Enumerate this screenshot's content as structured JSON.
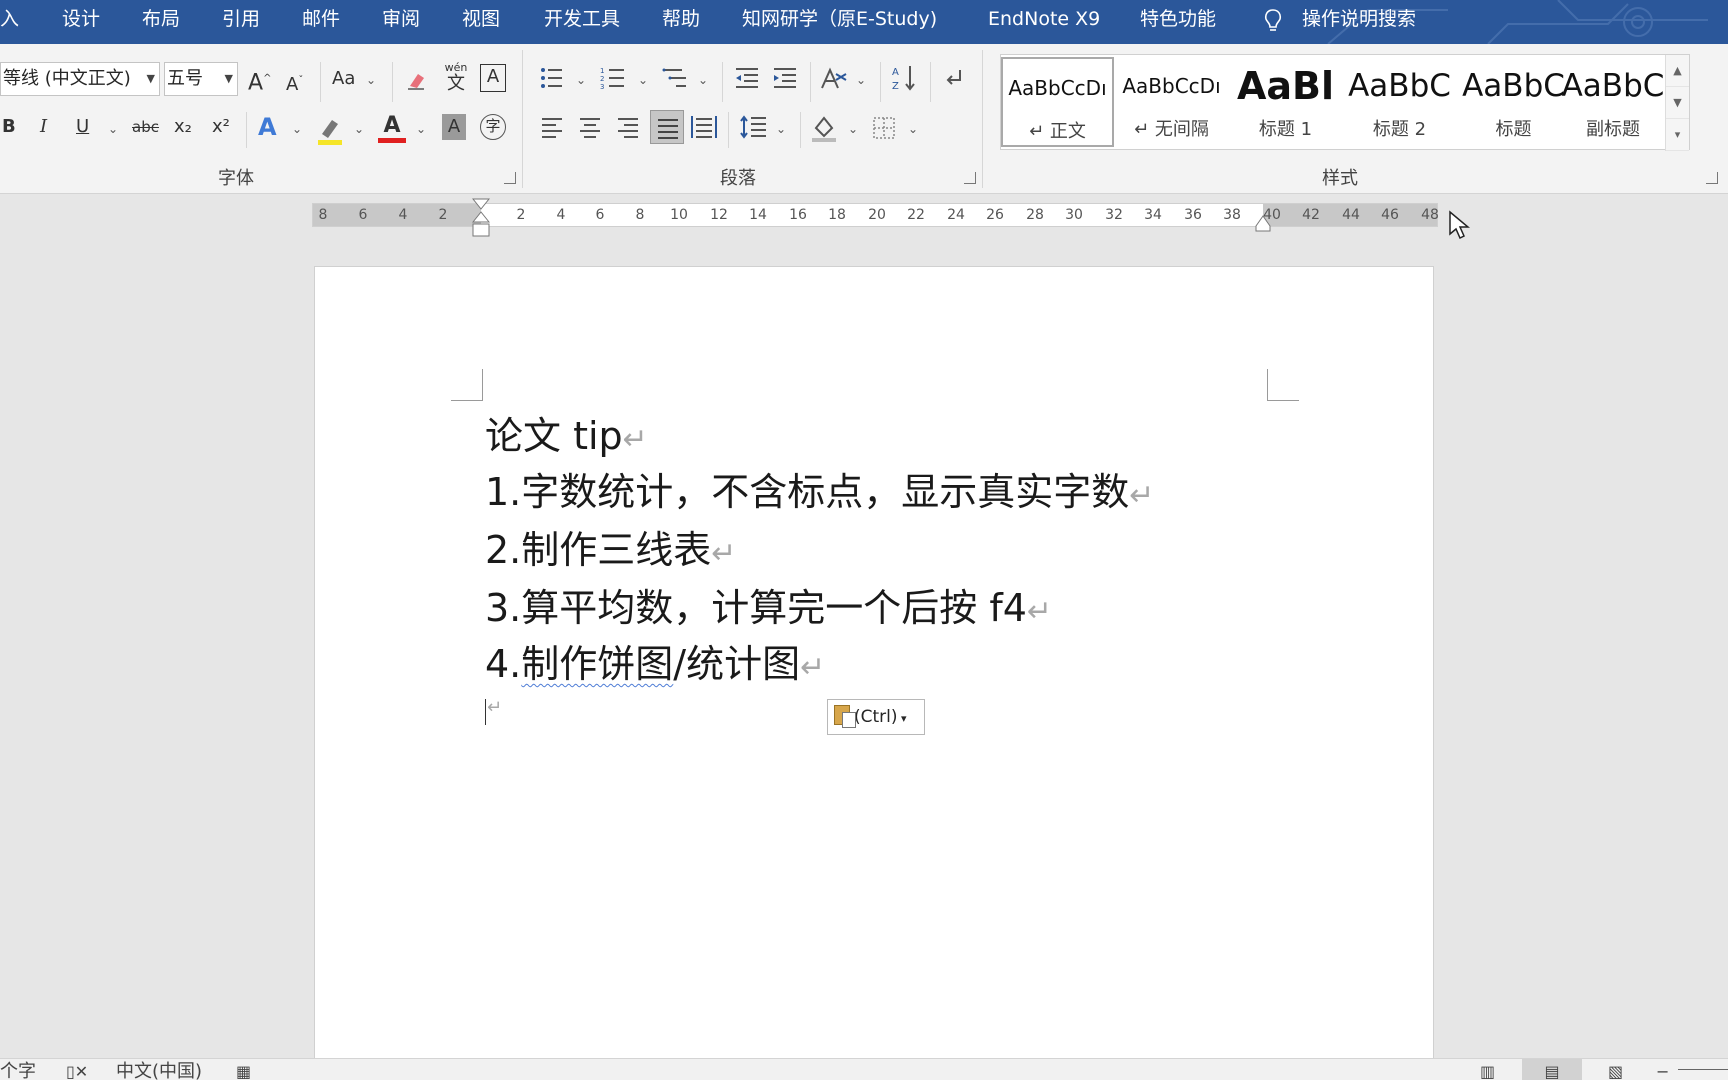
{
  "menu": {
    "tabs": [
      "入",
      "设计",
      "布局",
      "引用",
      "邮件",
      "审阅",
      "视图",
      "开发工具",
      "帮助",
      "知网研学（原E-Study)",
      "EndNote X9",
      "特色功能"
    ],
    "search_label": "操作说明搜索",
    "accent_color": "#2b579a"
  },
  "ribbon": {
    "font_group": {
      "label": "字体",
      "font_name": "等线 (中文正文)",
      "font_size": "五号",
      "change_case": "Aa",
      "bold": "B",
      "italic": "I",
      "underline": "U",
      "strikethrough": "abc",
      "subscript": "x₂",
      "superscript": "x²",
      "phonetic": "wén",
      "phonetic_char": "文"
    },
    "paragraph_group": {
      "label": "段落"
    },
    "styles_group": {
      "label": "样式",
      "items": [
        {
          "sample": "AaBbCcDı",
          "name": "↵ 正文"
        },
        {
          "sample": "AaBbCcDı",
          "name": "↵ 无间隔"
        },
        {
          "sample": "AaBl",
          "name": "标题 1"
        },
        {
          "sample": "AaBbC",
          "name": "标题 2"
        },
        {
          "sample": "AaBbC",
          "name": "标题"
        },
        {
          "sample": "AaBbC",
          "name": "副标题"
        }
      ]
    }
  },
  "ruler": {
    "left_ticks": [
      "8",
      "6",
      "4",
      "2"
    ],
    "right_ticks": [
      "2",
      "4",
      "6",
      "8",
      "10",
      "12",
      "14",
      "16",
      "18",
      "20",
      "22",
      "24",
      "26",
      "28",
      "30",
      "32",
      "34",
      "36",
      "38",
      "40",
      "42",
      "44",
      "46",
      "48"
    ]
  },
  "document": {
    "title": "论文 tip",
    "item1": "1.字数统计，不含标点，显示真实字数",
    "item2": "2.制作三线表",
    "item3": "3.算平均数，计算完一个后按 f4",
    "item4_prefix": "4.",
    "item4_underlined": "制作饼图",
    "item4_suffix": "/统计图",
    "paragraph_mark": "↵",
    "paste_options": "(Ctrl)"
  },
  "statusbar": {
    "word_count": "个字",
    "language": "中文(中国)"
  }
}
